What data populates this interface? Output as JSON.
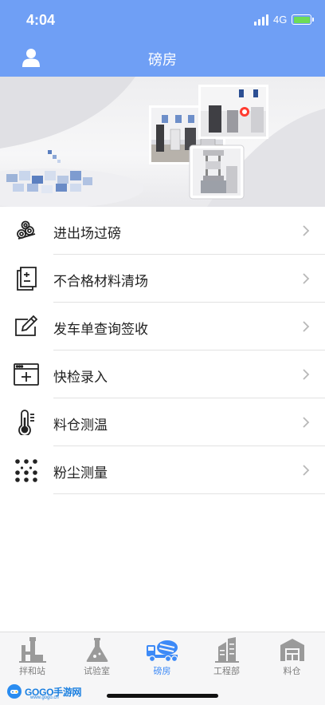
{
  "status_bar": {
    "time": "4:04",
    "network": "4G"
  },
  "header": {
    "title": "磅房"
  },
  "menu": {
    "items": [
      {
        "label": "进出场过磅",
        "icon": "pipes-icon"
      },
      {
        "label": "不合格材料清场",
        "icon": "document-minus-icon"
      },
      {
        "label": "发车单查询签收",
        "icon": "edit-icon"
      },
      {
        "label": "快检录入",
        "icon": "add-window-icon"
      },
      {
        "label": "料仓测温",
        "icon": "thermometer-icon"
      },
      {
        "label": "粉尘测量",
        "icon": "dust-dots-icon"
      }
    ]
  },
  "tabbar": {
    "tabs": [
      {
        "label": "拌和站",
        "icon": "mixing-station-icon"
      },
      {
        "label": "试验室",
        "icon": "flask-icon"
      },
      {
        "label": "磅房",
        "icon": "mixer-truck-icon",
        "active": true
      },
      {
        "label": "工程部",
        "icon": "building-icon"
      },
      {
        "label": "料仓",
        "icon": "warehouse-icon"
      }
    ]
  },
  "watermark": {
    "text": "GOGO手游网",
    "sub": "www.gogo.cn"
  },
  "colors": {
    "header": "#6f9ff5",
    "active_tab": "#3d8af7",
    "inactive_tab": "#7d7d7d",
    "battery": "#6ddc57"
  }
}
